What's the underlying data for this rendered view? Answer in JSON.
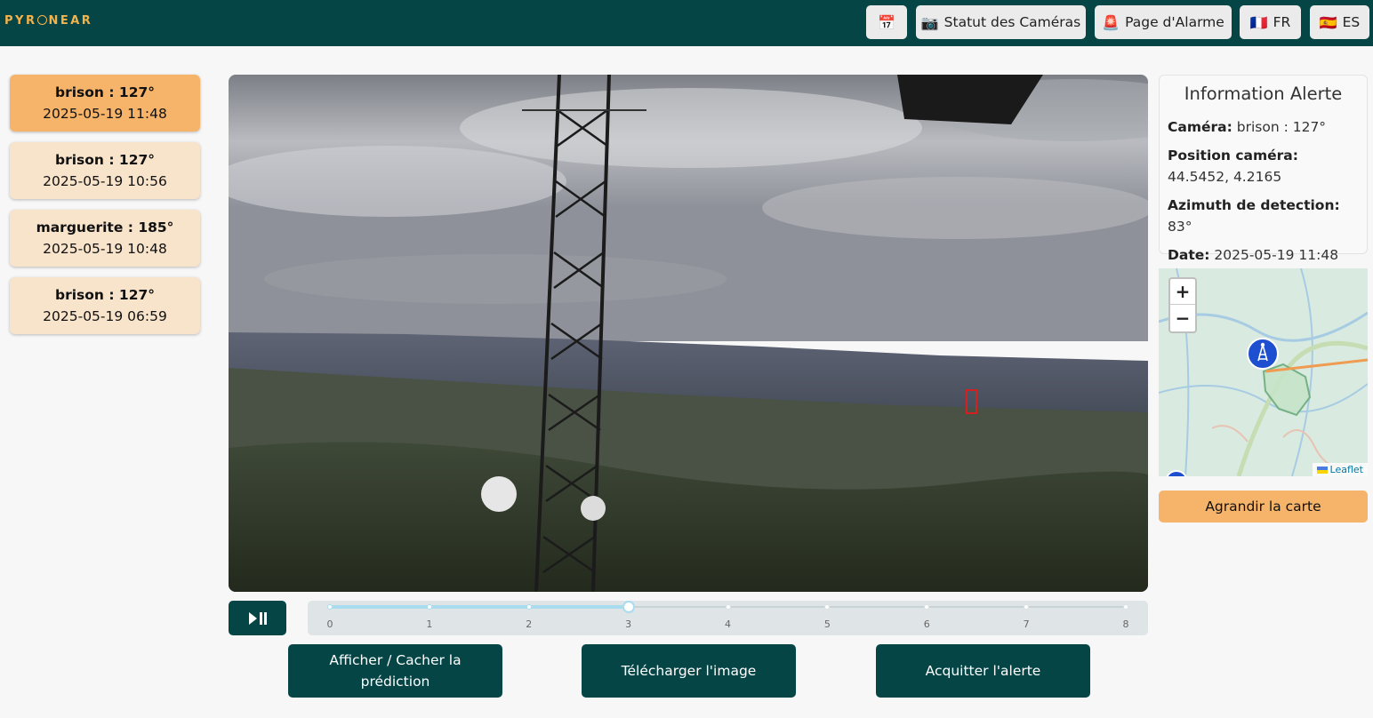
{
  "header": {
    "logo_text_left": "PYR",
    "logo_text_right": "NEAR",
    "calendar_icon": "📅",
    "camera_status": {
      "icon": "📷",
      "label": "Statut des Caméras"
    },
    "alarm_page": {
      "icon": "🚨",
      "label": "Page d'Alarme"
    },
    "lang_fr": {
      "icon": "🇫🇷",
      "label": "FR"
    },
    "lang_es": {
      "icon": "🇪🇸",
      "label": "ES"
    }
  },
  "alerts": [
    {
      "title": "brison : 127°",
      "date": "2025-05-19 11:48",
      "active": true
    },
    {
      "title": "brison : 127°",
      "date": "2025-05-19 10:56",
      "active": false
    },
    {
      "title": "marguerite : 185°",
      "date": "2025-05-19 10:48",
      "active": false
    },
    {
      "title": "brison : 127°",
      "date": "2025-05-19 06:59",
      "active": false
    }
  ],
  "timeline": {
    "labels": [
      "0",
      "1",
      "2",
      "3",
      "4",
      "5",
      "6",
      "7",
      "8"
    ],
    "current": 3
  },
  "actions": {
    "toggle_prediction": "Afficher / Cacher la prédiction",
    "download_image": "Télécharger l'image",
    "acknowledge": "Acquitter l'alerte"
  },
  "info": {
    "title": "Information Alerte",
    "camera_label": "Caméra:",
    "camera_value": "brison : 127°",
    "position_label": "Position caméra:",
    "position_value": "44.5452, 4.2165",
    "azimuth_label": "Azimuth de detection:",
    "azimuth_value": "83°",
    "date_label": "Date:",
    "date_value": "2025-05-19 11:48"
  },
  "map": {
    "zoom_in": "+",
    "zoom_out": "−",
    "attribution": "Leaflet"
  },
  "enlarge_map": "Agrandir la carte",
  "colors": {
    "primary": "#054546",
    "accent": "#f6b46a",
    "card_bg": "#f8e3cb",
    "detection_box": "#d42020"
  }
}
